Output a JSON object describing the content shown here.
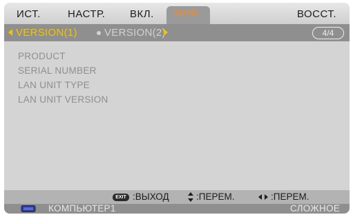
{
  "tabs": [
    {
      "label": "ИСТ."
    },
    {
      "label": "НАСТР."
    },
    {
      "label": "ВКЛ."
    },
    {
      "label": "ИНФ."
    },
    {
      "label": "ВОССТ."
    }
  ],
  "active_tab": "ИНФ.",
  "subtabs": [
    {
      "label": "VERSION(1)"
    },
    {
      "label": "VERSION(2)"
    }
  ],
  "active_subtab": "VERSION(1)",
  "page_indicator": "4/4",
  "info_items": [
    {
      "label": "PRODUCT"
    },
    {
      "label": "SERIAL NUMBER"
    },
    {
      "label": "LAN UNIT TYPE"
    },
    {
      "label": "LAN UNIT VERSION"
    }
  ],
  "help": {
    "exit_badge": "EXIT",
    "exit_text": ":ВЫХОД",
    "updown_text": ":ПЕРЕМ.",
    "leftright_text": ":ПЕРЕМ."
  },
  "status": {
    "source": "КОМПЬЮТЕР1",
    "mode": "СЛОЖНОЕ"
  },
  "colors": {
    "accent_active_tab": "#f08a2a",
    "accent_subtab": "#f5c400",
    "menu_bg": "#d4d4d4",
    "bar_gray": "#8f8f8f"
  }
}
